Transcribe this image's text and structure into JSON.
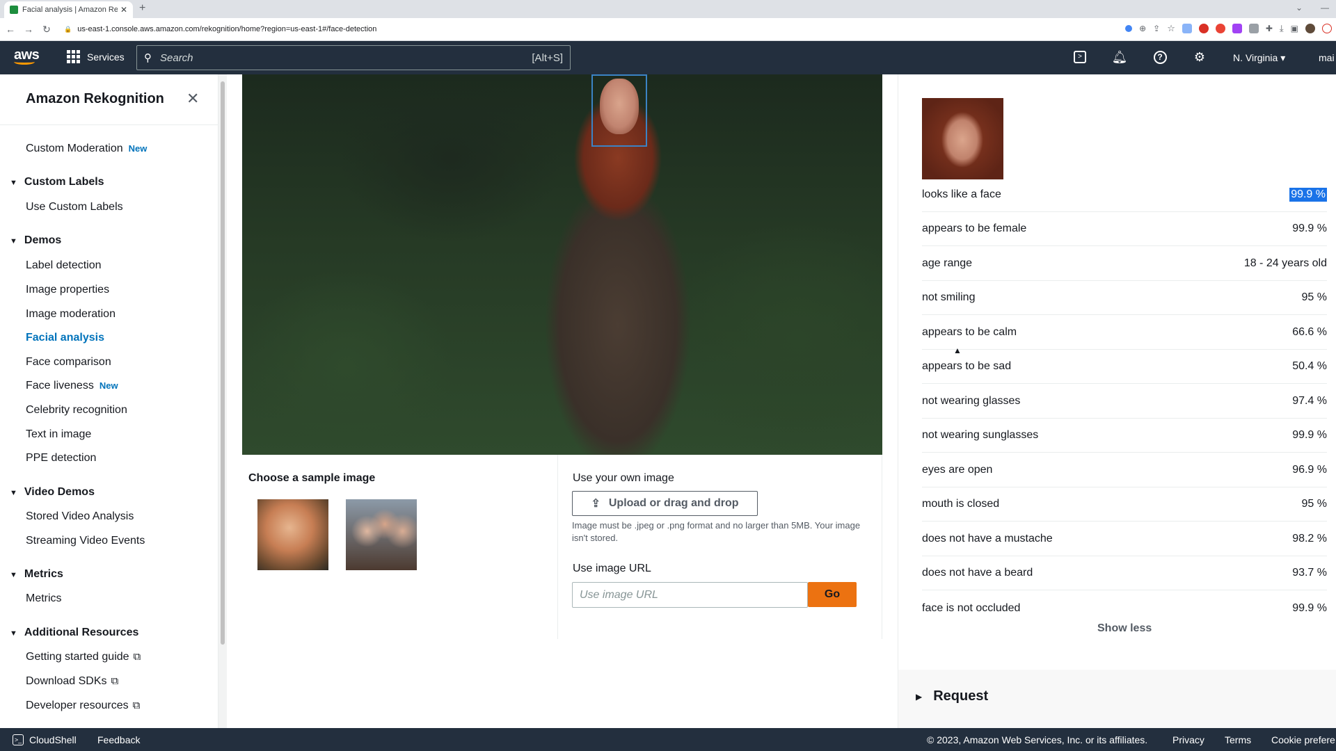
{
  "browser": {
    "tab_title": "Facial analysis | Amazon Rekognition",
    "new_tab": "+",
    "url": "us-east-1.console.aws.amazon.com/rekognition/home?region=us-east-1#/face-detection"
  },
  "header": {
    "logo": "aws",
    "services_label": "Services",
    "search_placeholder": "Search",
    "search_shortcut": "[Alt+S]",
    "region": "N. Virginia ▾",
    "account": "mai"
  },
  "sidebar": {
    "title": "Amazon Rekognition",
    "new_badge": "New",
    "custom_moderation": "Custom Moderation",
    "sections": {
      "custom_labels": "Custom Labels",
      "demos": "Demos",
      "video_demos": "Video Demos",
      "metrics": "Metrics",
      "additional_resources": "Additional Resources"
    },
    "items": {
      "use_custom_labels": "Use Custom Labels",
      "label_detection": "Label detection",
      "image_properties": "Image properties",
      "image_moderation": "Image moderation",
      "facial_analysis": "Facial analysis",
      "face_comparison": "Face comparison",
      "face_liveness": "Face liveness",
      "celebrity_recognition": "Celebrity recognition",
      "text_in_image": "Text in image",
      "ppe_detection": "PPE detection",
      "stored_video_analysis": "Stored Video Analysis",
      "streaming_video_events": "Streaming Video Events",
      "metrics": "Metrics",
      "getting_started_guide": "Getting started guide",
      "download_sdks": "Download SDKs",
      "developer_resources": "Developer resources"
    }
  },
  "main": {
    "sample_title": "Choose a sample image",
    "own_image_title": "Use your own image",
    "upload_label": "Upload or drag and drop",
    "upload_note": "Image must be .jpeg or .png format and no larger than 5MB. Your image isn't stored.",
    "url_title": "Use image URL",
    "url_placeholder": "Use image URL",
    "go_label": "Go"
  },
  "results": {
    "rows": [
      {
        "label": "looks like a face",
        "value": "99.9 %"
      },
      {
        "label": "appears to be female",
        "value": "99.9 %"
      },
      {
        "label": "age range",
        "value": "18 - 24 years old"
      },
      {
        "label": "not smiling",
        "value": "95 %"
      },
      {
        "label": "appears to be calm",
        "value": "66.6 %"
      },
      {
        "label": "appears to be sad",
        "value": "50.4 %"
      },
      {
        "label": "not wearing glasses",
        "value": "97.4 %"
      },
      {
        "label": "not wearing sunglasses",
        "value": "99.9 %"
      },
      {
        "label": "eyes are open",
        "value": "96.9 %"
      },
      {
        "label": "mouth is closed",
        "value": "95 %"
      },
      {
        "label": "does not have a mustache",
        "value": "98.2 %"
      },
      {
        "label": "does not have a beard",
        "value": "93.7 %"
      },
      {
        "label": "face is not occluded",
        "value": "99.9 %"
      }
    ],
    "show_less": "Show less",
    "request_label": "Request"
  },
  "footer": {
    "cloudshell": "CloudShell",
    "feedback": "Feedback",
    "copyright": "© 2023, Amazon Web Services, Inc. or its affiliates.",
    "privacy": "Privacy",
    "terms": "Terms",
    "cookies": "Cookie prefere"
  },
  "colors": {
    "header_bg": "#232f3e",
    "accent_link": "#0073bb",
    "go_button": "#ec7211",
    "face_box": "#3b83c5"
  }
}
